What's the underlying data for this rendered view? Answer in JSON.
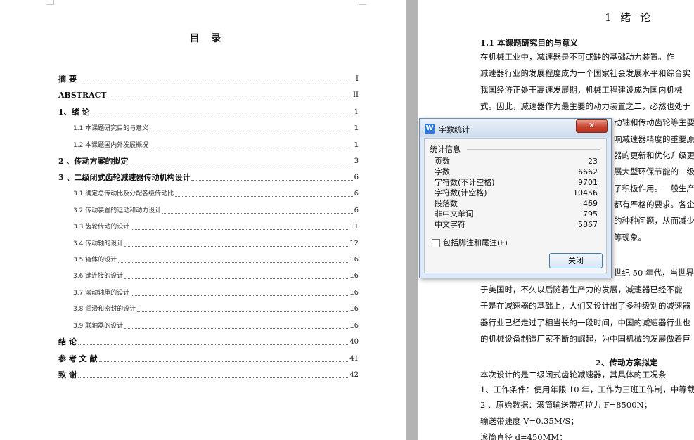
{
  "toc": {
    "title": "目 录",
    "entries": [
      {
        "text": "摘  要",
        "page": "I"
      },
      {
        "text": "ABSTRACT",
        "page": "II"
      },
      {
        "text": "1、绪  论",
        "page": "1"
      },
      {
        "text": "1.1 本课题研究目的与意义",
        "page": "1"
      },
      {
        "text": "1.2 本课题国内外发展概况",
        "page": "1"
      },
      {
        "text": "2 、传动方案的拟定",
        "page": "3"
      },
      {
        "text": "3 、二级闭式齿轮减速器传动机构设计",
        "page": "6"
      },
      {
        "text": "3.1 确定总传动比及分配各级传动比",
        "page": "6"
      },
      {
        "text": "3.2  传动装置的运动和动力设计",
        "page": "6"
      },
      {
        "text": "3.3  齿轮传动的设计",
        "page": "11"
      },
      {
        "text": "3.4  传动轴的设计",
        "page": "12"
      },
      {
        "text": "3.5  箱体的设计",
        "page": "16"
      },
      {
        "text": "3.6 键连接的设计",
        "page": "16"
      },
      {
        "text": "3.7 滚动轴承的设计",
        "page": "16"
      },
      {
        "text": "3.8 润滑和密封的设计",
        "page": "16"
      },
      {
        "text": "3.9 联轴器的设计",
        "page": "16"
      },
      {
        "text": "结  论",
        "page": "40"
      },
      {
        "text": "参 考 文 献",
        "page": "41"
      },
      {
        "text": "致  谢",
        "page": "42"
      }
    ]
  },
  "document": {
    "chapter_title": "1  绪  论",
    "section_title": "1.1 本课题研究目的与意义",
    "section2_title": "2、传动方案拟定",
    "lines": [
      "      在机械工业中，减速器是不可或缺的基础动力装置。作",
      "减速器行业的发展程度成为一个国家社会发展水平和综合实",
      "我国经济正处于高速发展期，机械工程建设成为国内机械",
      "式。因此，减速器作为最主要的动力装置之二，必然也处于",
      "动轴和传动齿轮等主要",
      "响减速器精度的重要原因",
      "器的更新和优化升级更",
      "展大型环保节能的二级",
      "了积极作用。一般生产",
      "都有严格的要求。各企",
      "的种种问题，从而减少",
      "等现象。",
      "世纪 50 年代，当世界",
      "于美国时，不久以后随着生产力的发展，减速器已经不能",
      "于是在减速器的基础上，人们又设计出了多种级别的减速器",
      "器行业已经走过了相当长的一段时间，中国的减速器行业也",
      "的机械设备制造厂家不断的崛起，为中国机械的发展做着巨",
      "      本次设计的是二级闭式齿轮减速器，其具体的工况条",
      "1、工作条件：使用年限 10 年，工作为三班工作制，中等载",
      " 2 、原始数据：滚筒输送带初拉力 F=8500N；",
      "                      输送带速度 V=0.35M/S；",
      "                      滚筒直径 d=450MM；"
    ]
  },
  "dialog": {
    "title": "字数统计",
    "logo": "W",
    "close_glyph": "✕",
    "group_label": "统计信息",
    "stats": [
      {
        "label": "页数",
        "value": "23"
      },
      {
        "label": "字数",
        "value": "6662"
      },
      {
        "label": "字符数(不计空格)",
        "value": "9701"
      },
      {
        "label": "字符数(计空格)",
        "value": "10456"
      },
      {
        "label": "段落数",
        "value": "469"
      },
      {
        "label": "非中文单词",
        "value": "795"
      },
      {
        "label": "中文字符",
        "value": "5867"
      }
    ],
    "checkbox_label": "包括脚注和尾注(F)",
    "button_label": "关闭"
  }
}
